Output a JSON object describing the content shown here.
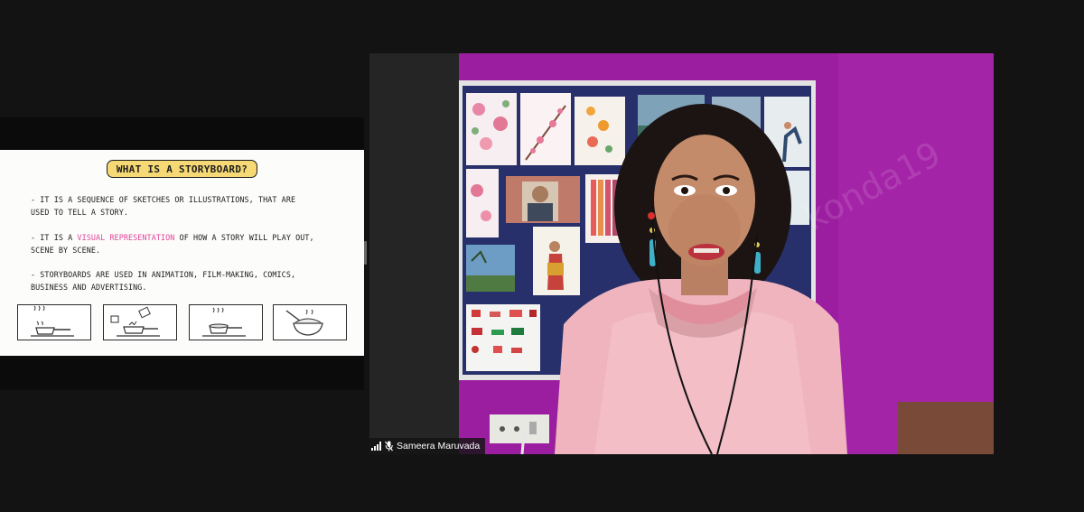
{
  "shared_screen": {
    "slide": {
      "title": "WHAT IS A STORYBOARD?",
      "bullets": [
        {
          "line1": "- IT IS A SEQUENCE OF SKETCHES OR ILLUSTRATIONS, THAT ARE",
          "line2": "USED TO TELL A STORY."
        },
        {
          "prefix": "- IT IS A ",
          "highlight": "VISUAL REPRESENTATION",
          "suffix": " OF HOW A STORY WILL PLAY OUT,",
          "line2": "SCENE BY SCENE."
        },
        {
          "line1": "-  STORYBOARDS ARE USED IN ANIMATION, FILM-MAKING, COMICS,",
          "line2": "BUSINESS AND ADVERTISING."
        }
      ],
      "frames": [
        "pan-on-stove-icon",
        "adding-ingredients-icon",
        "cooking-pan-icon",
        "food-bowl-icon"
      ],
      "highlight_color": "#e0459a",
      "title_badge_color": "#f6d874"
    }
  },
  "video": {
    "participant_name": "Sameera Maruvada",
    "watermark": "konda19",
    "icons": [
      "signal-strength-icon",
      "muted-mic-icon"
    ],
    "wall_color": "#9c1ea0"
  }
}
